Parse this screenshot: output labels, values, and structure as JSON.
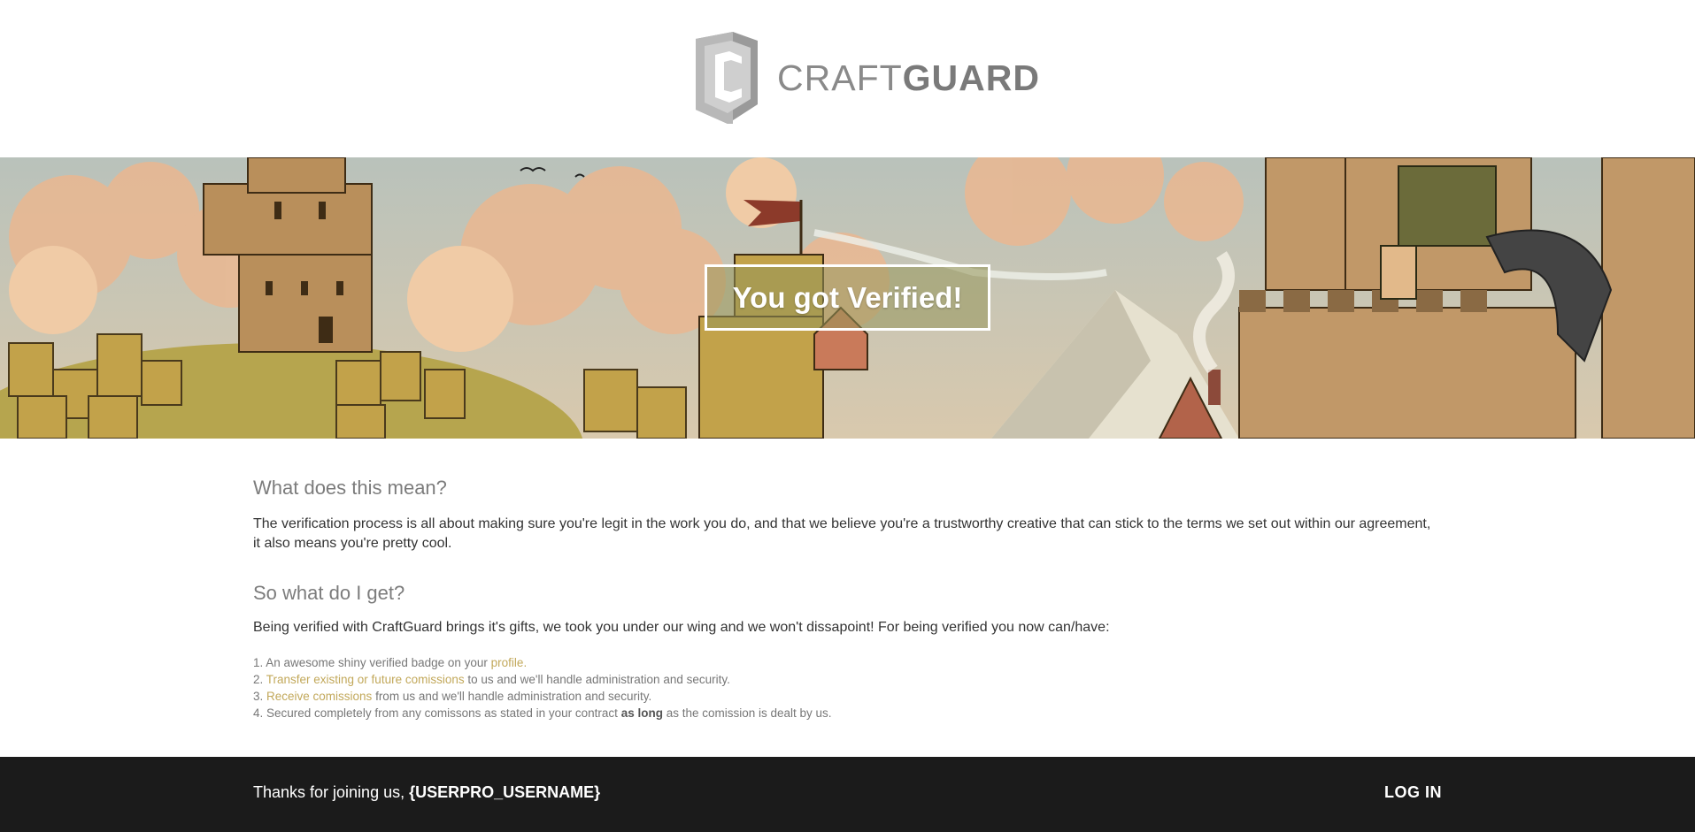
{
  "brand": {
    "name_light": "CRAFT",
    "name_bold": "GUARD",
    "logo_icon": "shield-c-icon"
  },
  "banner": {
    "headline": "You got Verified!"
  },
  "section_meaning": {
    "title": "What does this mean?",
    "body": "The verification process is all about making sure you're legit in the work you do, and that we believe you're a trustworthy creative that can stick to the terms we set out within our agreement, it also means you're pretty cool."
  },
  "section_benefits": {
    "title": "So what do I get?",
    "intro": "Being verified with CraftGuard brings it's gifts, we took you under our wing and we won't dissapoint! For being verified you now can/have:",
    "items": [
      {
        "prefix": "1. An awesome shiny verified badge on your ",
        "link": "profile.",
        "suffix": ""
      },
      {
        "prefix": "2. ",
        "link": "Transfer existing or future comissions",
        "suffix": " to us and we'll handle administration and security."
      },
      {
        "prefix": "3. ",
        "link": "Receive comissions",
        "suffix": " from us and we'll handle administration and security."
      },
      {
        "prefix": "4. Secured completely from any comissons as stated in your contract ",
        "bold": "as long",
        "suffix": " as the comission is dealt by us."
      }
    ]
  },
  "footer": {
    "thanks_text": "Thanks for joining us, ",
    "username": "{USERPRO_USERNAME}",
    "login_label": "LOG IN"
  },
  "colors": {
    "accent_link": "#c2a85a",
    "footer_bg": "#1b1b1b",
    "logo_gray": "#8a8a8a"
  }
}
